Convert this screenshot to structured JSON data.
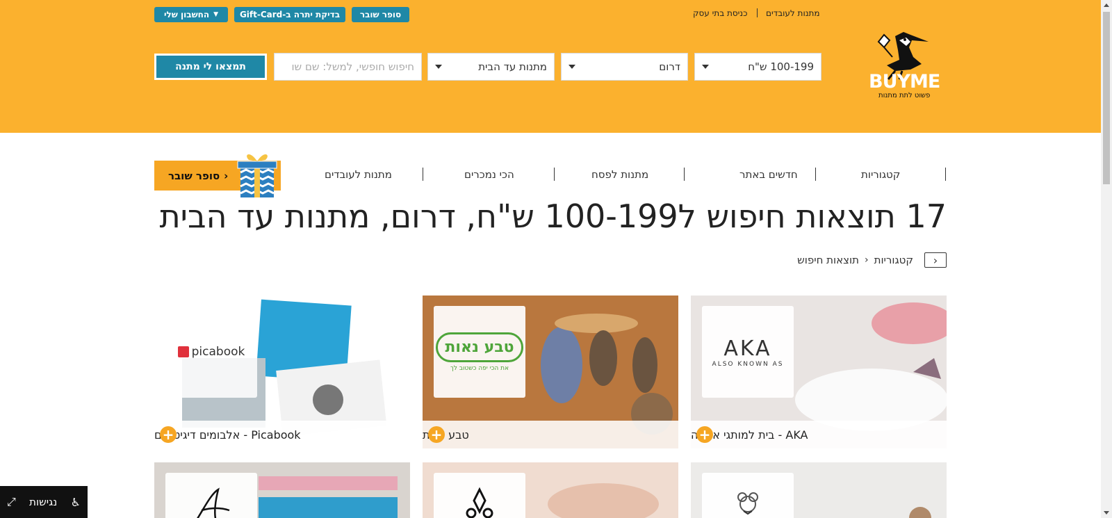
{
  "header": {
    "top_buttons": {
      "my_account": "החשבון שלי",
      "gift_card_balance": "בדיקת יתרה ב-Gift-Card",
      "super_buyer": "סופר שובר"
    },
    "top_links": {
      "business_login": "כניסת בתי עסק",
      "employee_gifts": "מתנות לעובדים"
    },
    "search": {
      "price_value": "100-199 ש\"ח",
      "region_value": "דרום",
      "category_value": "מתנות עד הבית",
      "free_text_placeholder": "חיפוש חופשי, למשל: שם שו",
      "submit_label": "תמצאו לי מתנה"
    },
    "logo": {
      "brand": "BUYME",
      "tagline": "פשוט לתת מתנות"
    }
  },
  "nav": {
    "items": [
      "קטגוריות",
      "חדשים באתר",
      "מתנות לפסח",
      "הכי נמכרים",
      "מתנות לעובדים"
    ],
    "promo_button": "סופר שובר"
  },
  "page": {
    "title": "17 תוצאות חיפוש ל100-199 ש\"ח, דרום, מתנות עד הבית",
    "breadcrumb": [
      "קטגוריות",
      "תוצאות חיפוש"
    ]
  },
  "cards": [
    {
      "name": "AKA - בית למותגי אופנה",
      "logo_text": "AKA",
      "logo_sub": "ALSO KNOWN AS"
    },
    {
      "name": "טבע נאות",
      "logo_text": "טבע נאות",
      "logo_sub": "את הכי יפה כשטוב לך"
    },
    {
      "name": "Picabook - אלבומים דיגיטליים",
      "logo_text": "picabook",
      "logo_sub": ""
    },
    {
      "name": "",
      "logo_text": "",
      "logo_sub": ""
    },
    {
      "name": "",
      "logo_text": "",
      "logo_sub": ""
    },
    {
      "name": "",
      "logo_text": "",
      "logo_sub": ""
    }
  ],
  "accessibility": {
    "label": "נגישות"
  },
  "colors": {
    "header_bg": "#fbb12e",
    "accent_blue": "#1f88a6",
    "accent_orange": "#f6a623"
  },
  "icons": [
    "chevron-down-icon",
    "chevron-left-icon",
    "plus-icon",
    "wheelchair-icon",
    "expand-icon",
    "gift-box-icon",
    "pelican-logo-icon"
  ]
}
